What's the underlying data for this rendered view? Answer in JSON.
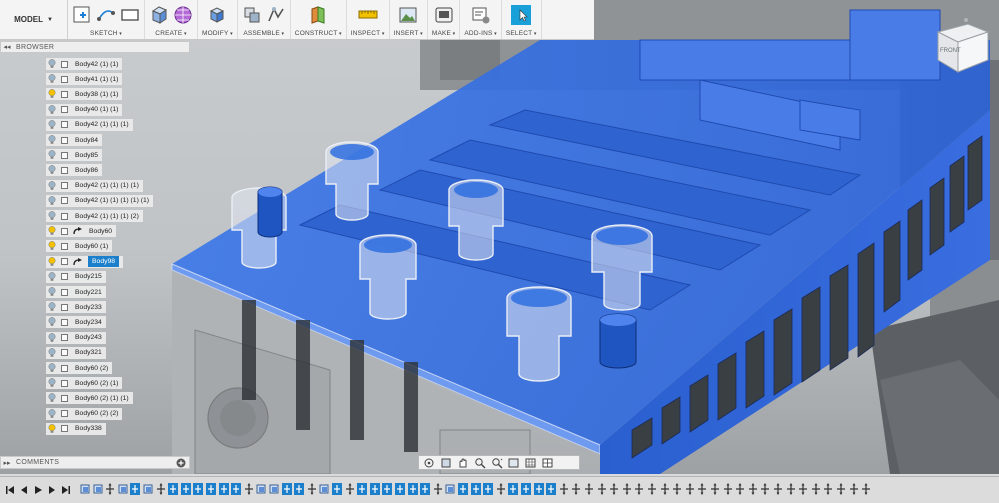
{
  "toolbar": {
    "workspace": "MODEL",
    "groups": [
      {
        "label": "SKETCH",
        "icons": [
          "sketch-create-icon",
          "arc-icon",
          "rectangle-icon"
        ]
      },
      {
        "label": "CREATE",
        "icons": [
          "extrude-box-icon",
          "create-form-icon"
        ]
      },
      {
        "label": "MODIFY",
        "icons": [
          "press-pull-icon"
        ]
      },
      {
        "label": "ASSEMBLE",
        "icons": [
          "new-component-icon",
          "joint-icon"
        ]
      },
      {
        "label": "CONSTRUCT",
        "icons": [
          "offset-plane-icon"
        ]
      },
      {
        "label": "INSPECT",
        "icons": [
          "measure-icon"
        ]
      },
      {
        "label": "INSERT",
        "icons": [
          "insert-image-icon"
        ]
      },
      {
        "label": "MAKE",
        "icons": [
          "print-icon"
        ]
      },
      {
        "label": "ADD-INS",
        "icons": [
          "scripts-icon"
        ]
      },
      {
        "label": "SELECT",
        "icons": [
          "select-icon"
        ]
      }
    ]
  },
  "browser": {
    "title": "BROWSER",
    "items": [
      {
        "label": "Body42 (1) (1)",
        "visible": false
      },
      {
        "label": "Body41 (1) (1)",
        "visible": false
      },
      {
        "label": "Body38 (1) (1)",
        "visible": true
      },
      {
        "label": "Body40 (1) (1)",
        "visible": false
      },
      {
        "label": "Body42 (1) (1) (1)",
        "visible": false
      },
      {
        "label": "Body84",
        "visible": false
      },
      {
        "label": "Body85",
        "visible": false
      },
      {
        "label": "Body86",
        "visible": false
      },
      {
        "label": "Body42 (1) (1) (1) (1)",
        "visible": false
      },
      {
        "label": "Body42 (1) (1) (1) (1) (1)",
        "visible": false
      },
      {
        "label": "Body42 (1) (1) (1) (2)",
        "visible": false
      },
      {
        "label": "Body60",
        "visible": true,
        "linked": true
      },
      {
        "label": "Body60 (1)",
        "visible": true
      },
      {
        "label": "Body98",
        "visible": true,
        "linked": true,
        "selected": true
      },
      {
        "label": "Body215",
        "visible": false
      },
      {
        "label": "Body221",
        "visible": false
      },
      {
        "label": "Body233",
        "visible": false
      },
      {
        "label": "Body234",
        "visible": false
      },
      {
        "label": "Body243",
        "visible": false
      },
      {
        "label": "Body321",
        "visible": false
      },
      {
        "label": "Body60 (2)",
        "visible": false
      },
      {
        "label": "Body60 (2) (1)",
        "visible": false
      },
      {
        "label": "Body60 (2) (1) (1)",
        "visible": false
      },
      {
        "label": "Body60 (2) (2)",
        "visible": false
      },
      {
        "label": "Body338",
        "visible": true
      }
    ]
  },
  "comments": {
    "title": "COMMENTS"
  },
  "viewcube": {
    "face_label": "FRONT"
  },
  "navbar": {
    "icons": [
      "orbit-icon",
      "look-at-icon",
      "pan-icon",
      "zoom-icon",
      "fit-icon",
      "display-settings-icon",
      "grid-icon",
      "viewports-icon"
    ]
  },
  "timeline": {
    "controls": [
      "go-to-start-icon",
      "step-back-icon",
      "play-icon",
      "step-forward-icon",
      "go-to-end-icon"
    ]
  },
  "colors": {
    "selection_blue": "#2f6fe0",
    "browser_selected": "#1b7fcc",
    "bulb_on": "#f2c200",
    "bulb_off": "#9cb4c8"
  }
}
